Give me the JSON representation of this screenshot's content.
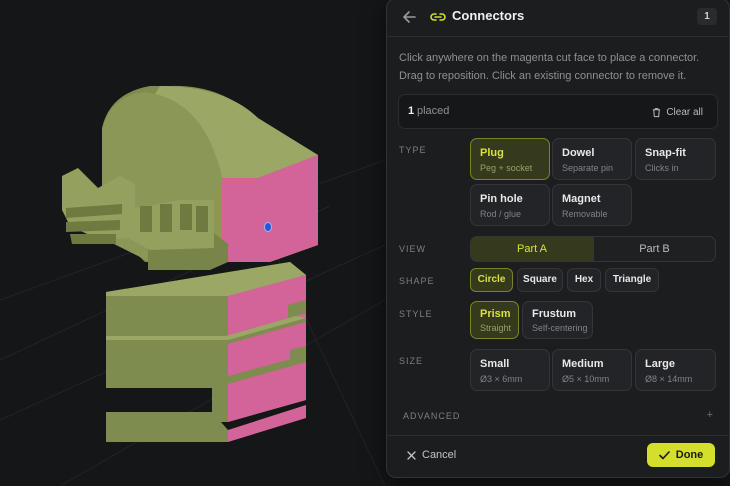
{
  "colors": {
    "accent": "#d3df2a",
    "model": "#8b985a",
    "cut_face": "#d06295",
    "panel": "#1c1d1f"
  },
  "panel": {
    "title": "Connectors",
    "count": "1",
    "description": "Click anywhere on the magenta cut face to place a connector. Drag to reposition. Click an existing connector to remove it.",
    "placed_count": "1",
    "placed_label": "placed",
    "clear_label": "Clear all",
    "sections": {
      "type": "TYPE",
      "view": "VIEW",
      "shape": "SHAPE",
      "style": "STYLE",
      "size": "SIZE",
      "advanced": "ADVANCED"
    },
    "types": [
      {
        "title": "Plug",
        "sub": "Peg + socket",
        "selected": true
      },
      {
        "title": "Dowel",
        "sub": "Separate pin",
        "selected": false
      },
      {
        "title": "Snap-fit",
        "sub": "Clicks in",
        "selected": false
      },
      {
        "title": "Pin hole",
        "sub": "Rod / glue",
        "selected": false
      },
      {
        "title": "Magnet",
        "sub": "Removable",
        "selected": false
      }
    ],
    "views": [
      {
        "label": "Part A",
        "selected": true
      },
      {
        "label": "Part B",
        "selected": false
      }
    ],
    "shapes": [
      {
        "label": "Circle",
        "selected": true
      },
      {
        "label": "Square",
        "selected": false
      },
      {
        "label": "Hex",
        "selected": false
      },
      {
        "label": "Triangle",
        "selected": false
      }
    ],
    "styles": [
      {
        "title": "Prism",
        "sub": "Straight",
        "selected": true
      },
      {
        "title": "Frustum",
        "sub": "Self-centering",
        "selected": false
      }
    ],
    "sizes": [
      {
        "title": "Small",
        "sub": "Ø3 × 6mm",
        "selected": false
      },
      {
        "title": "Medium",
        "sub": "Ø5 × 10mm",
        "selected": false
      },
      {
        "title": "Large",
        "sub": "Ø8 × 14mm",
        "selected": false
      }
    ],
    "advanced_toggle": "+",
    "cancel_label": "Cancel",
    "done_label": "Done"
  },
  "icons": [
    "back-arrow-icon",
    "link-icon",
    "trash-icon",
    "close-icon",
    "check-icon",
    "connector-marker-icon"
  ]
}
